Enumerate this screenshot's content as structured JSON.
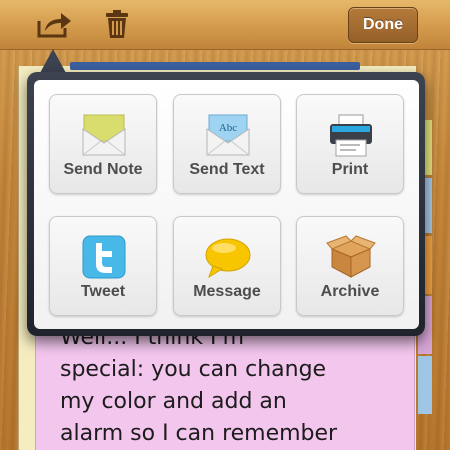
{
  "toolbar": {
    "done_label": "Done"
  },
  "actions": [
    {
      "label": "Send Note",
      "icon": "envelope-note-icon"
    },
    {
      "label": "Send Text",
      "icon": "envelope-text-icon"
    },
    {
      "label": "Print",
      "icon": "printer-icon"
    },
    {
      "label": "Tweet",
      "icon": "twitter-icon"
    },
    {
      "label": "Message",
      "icon": "message-bubble-icon"
    },
    {
      "label": "Archive",
      "icon": "archive-box-icon"
    }
  ],
  "envelope_badge": "Abc",
  "note": {
    "lines": [
      "Well... I think I'm",
      "special: you can change",
      "my color and add an",
      "alarm so I can remember"
    ]
  },
  "colors": {
    "note_pink": "#f3c6ee",
    "done_button": "#94602a",
    "popover_frame": "#2b303b"
  }
}
